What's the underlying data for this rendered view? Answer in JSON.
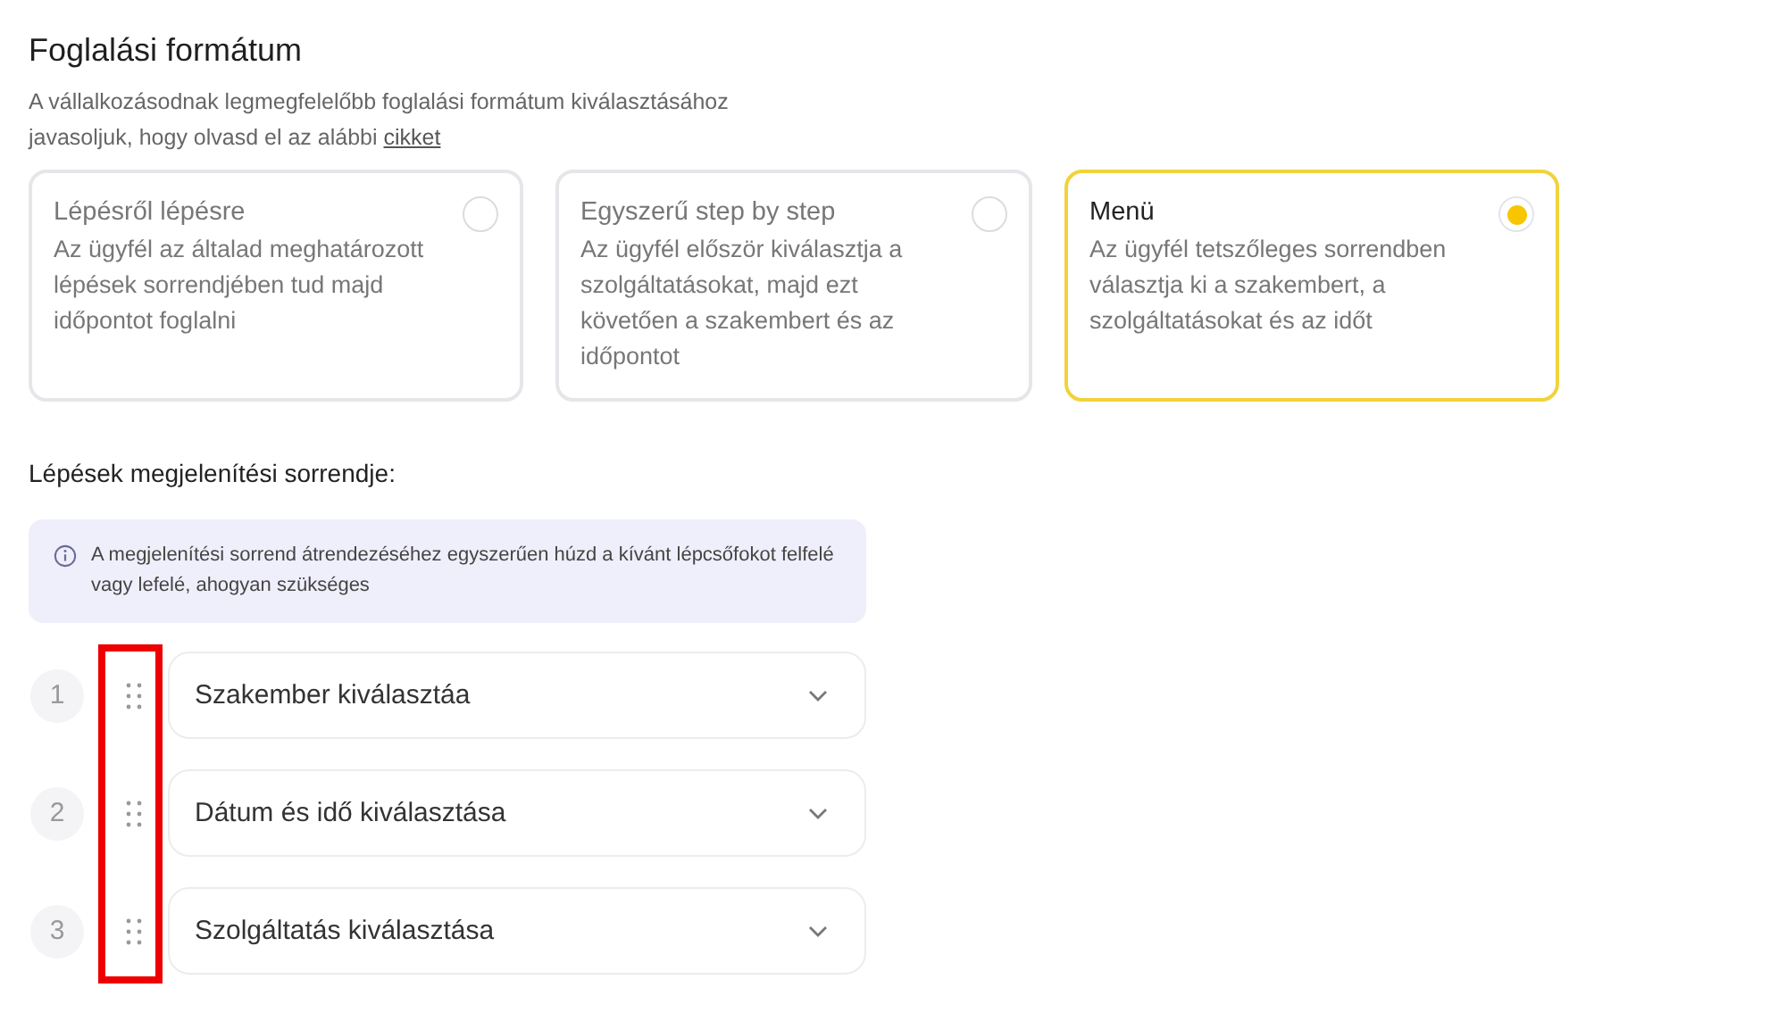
{
  "title": "Foglalási formátum",
  "intro": {
    "text": "A vállalkozásodnak legmegfelelőbb foglalási formátum kiválasztásához javasoljuk, hogy olvasd el az alábbi",
    "link": "cikket"
  },
  "formats": [
    {
      "title": "Lépésről lépésre",
      "description": "Az ügyfél az általad meghatározott lépések sorrendjében tud majd időpontot foglalni",
      "selected": false
    },
    {
      "title": "Egyszerű step by step",
      "description": "Az ügyfél először kiválasztja a szolgáltatásokat, majd ezt követően a szakembert és az időpontot",
      "selected": false
    },
    {
      "title": "Menü",
      "description": "Az ügyfél tetszőleges sorrendben választja ki a szakembert, a szolgáltatásokat és az időt",
      "selected": true
    }
  ],
  "order_heading": "Lépések megjelenítési sorrendje:",
  "info": "A megjelenítési sorrend átrendezéséhez egyszerűen húzd a kívánt lépcsőfokot felfelé vagy lefelé, ahogyan szükséges",
  "steps": [
    {
      "number": "1",
      "label": "Szakember kiválasztáa"
    },
    {
      "number": "2",
      "label": "Dátum és idő kiválasztása"
    },
    {
      "number": "3",
      "label": "Szolgáltatás kiválasztása"
    }
  ]
}
